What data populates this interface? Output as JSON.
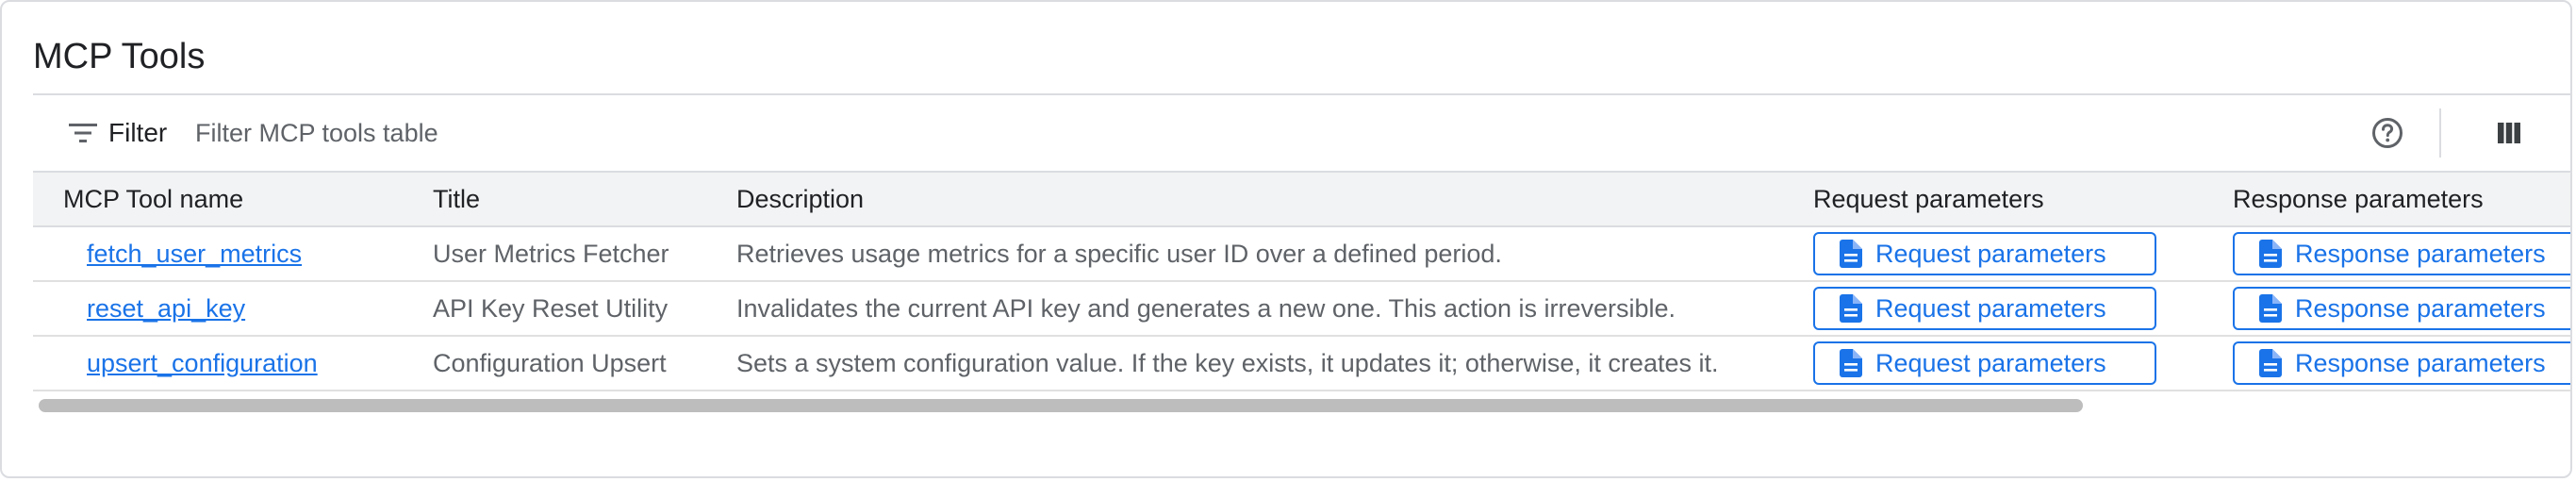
{
  "card": {
    "title": "MCP Tools"
  },
  "toolbar": {
    "filter_label": "Filter",
    "filter_placeholder": "Filter MCP tools table",
    "filter_value": "",
    "help_icon": "help-circle-icon",
    "columns_icon": "view-columns-icon"
  },
  "table": {
    "columns": [
      "MCP Tool name",
      "Title",
      "Description",
      "Request parameters",
      "Response parameters"
    ],
    "rows": [
      {
        "name": "fetch_user_metrics",
        "title": "User Metrics Fetcher",
        "description": "Retrieves usage metrics for a specific user ID over a defined period.",
        "request_button": "Request parameters",
        "response_button": "Response parameters"
      },
      {
        "name": "reset_api_key",
        "title": "API Key Reset Utility",
        "description": "Invalidates the current API key and generates a new one. This action is irreversible.",
        "request_button": "Request parameters",
        "response_button": "Response parameters"
      },
      {
        "name": "upsert_configuration",
        "title": "Configuration Upsert",
        "description": "Sets a system configuration value. If the key exists, it updates it; otherwise, it creates it.",
        "request_button": "Request parameters",
        "response_button": "Response parameters"
      }
    ]
  },
  "colors": {
    "link": "#1a73e8",
    "header_bg": "#f1f3f4",
    "border": "#dadce0",
    "muted_text": "#5f6368",
    "scrollbar_thumb": "#bdbdbd"
  }
}
